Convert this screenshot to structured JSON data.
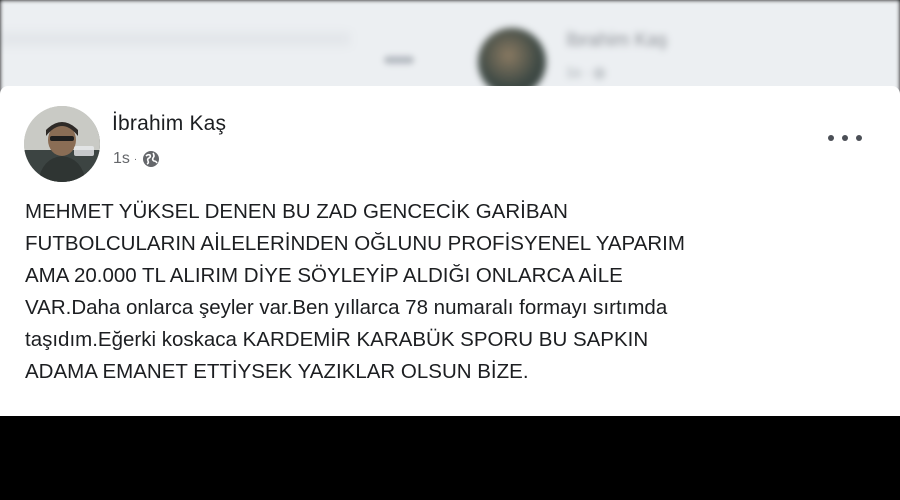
{
  "background_post": {
    "author": "İbrahim Kaş",
    "meta": "1s · ◍"
  },
  "post": {
    "author": "İbrahim Kaş",
    "time": "1s",
    "separator": "·",
    "privacy_icon": "globe-icon",
    "more_icon": "more-options-icon",
    "text": "MEHMET YÜKSEL DENEN BU ZAD GENCECİK GARİBAN\nFUTBOLCULARIN AİLELERİNDEN OĞLUNU PROFİSYENEL YAPARIM\nAMA 20.000 TL ALIRIM DİYE SÖYLEYİP ALDIĞI ONLARCA AİLE\nVAR.Daha onlarca şeyler var.Ben yıllarca 78 numaralı formayı sırtımda\ntaşıdım.Eğerki koskaca KARDEMİR KARABÜK SPORU BU SAPKIN\nADAMA EMANET ETTİYSEK YAZIKLAR OLSUN BİZE."
  },
  "colors": {
    "card_background": "#ffffff",
    "text": "#1c1e21",
    "secondary_text": "#65676b",
    "page_background": "#000000"
  }
}
